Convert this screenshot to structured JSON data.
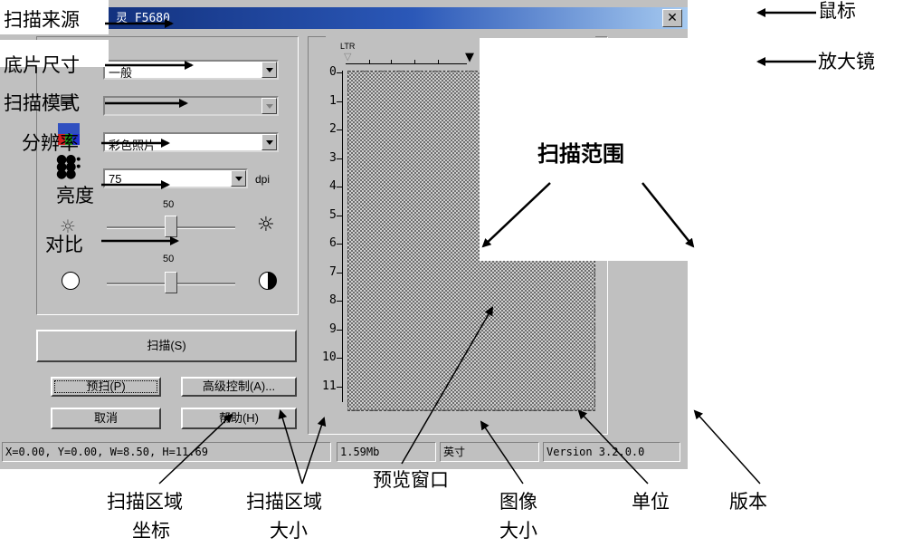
{
  "window": {
    "title": "灵 F5680",
    "close": "✕"
  },
  "panel": {
    "film_size_value": "一般",
    "resolution_value": "75",
    "resolution_unit": "dpi",
    "scan_type_value": "彩色照片",
    "brightness_value": "50",
    "contrast_value": "50",
    "scan_button": "扫描(S)",
    "prescan_button": "预扫(P)",
    "advanced_button": "高级控制(A)...",
    "cancel_button": "取消",
    "help_button": "帮助(H)"
  },
  "preview": {
    "ruler_label": "LTR",
    "y_ticks": [
      "0",
      "1",
      "2",
      "3",
      "4",
      "5",
      "6",
      "7",
      "8",
      "9",
      "10",
      "11"
    ]
  },
  "status": {
    "coords": "X=0.00, Y=0.00, W=8.50, H=11.69",
    "image_size": "1.59Mb",
    "unit": "英寸",
    "version": "Version 3.2.0.0"
  },
  "annotations": {
    "scan_source": "扫描来源",
    "film_size": "底片尺寸",
    "scan_mode": "扫描模式",
    "resolution": "分辨率",
    "brightness": "亮度",
    "contrast": "对比",
    "mouse": "鼠标",
    "magnifier": "放大镜",
    "scan_range": "扫描范围",
    "preview_window": "预览窗口",
    "area_coords_1": "扫描区域",
    "area_coords_2": "坐标",
    "area_size_1": "扫描区域",
    "area_size_2": "大小",
    "image_size_1": "图像",
    "image_size_2": "大小",
    "unit": "单位",
    "version": "版本"
  }
}
